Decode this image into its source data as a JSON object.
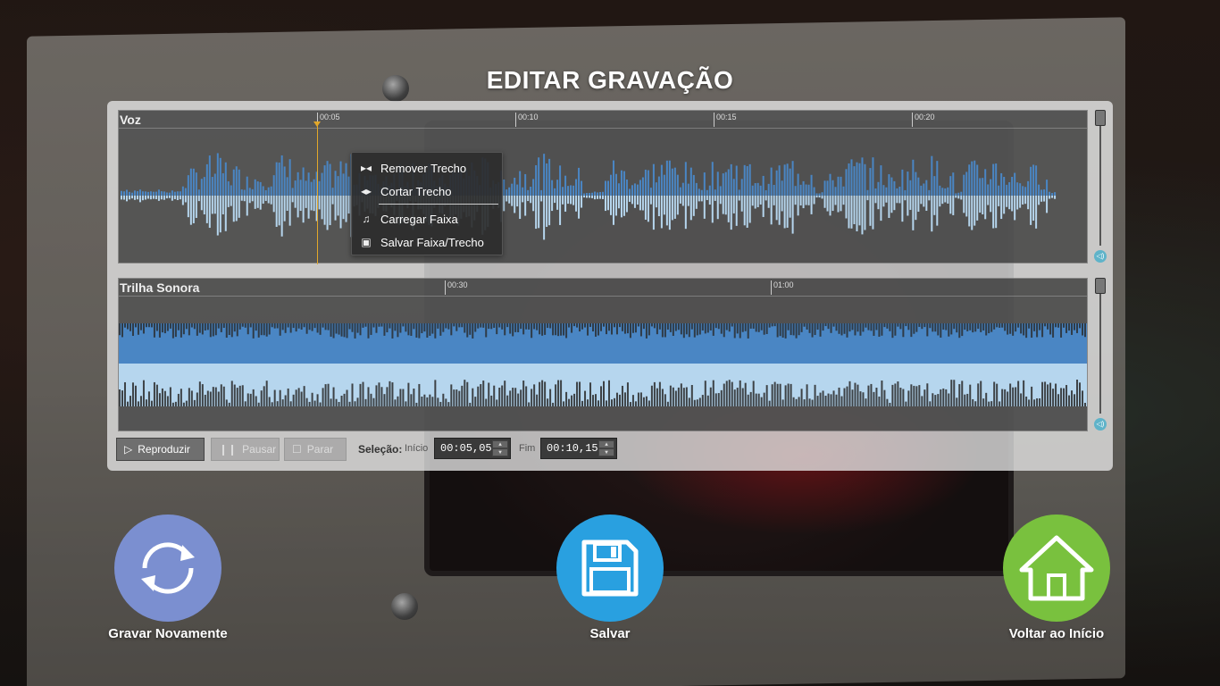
{
  "title": "EDITAR GRAVAÇÃO",
  "tracks": {
    "voz": {
      "label": "Voz",
      "ticks": [
        "00:05",
        "00:10",
        "00:15",
        "00:20"
      ]
    },
    "trilha": {
      "label": "Trilha Sonora",
      "ticks": [
        "00:30",
        "01:00"
      ]
    }
  },
  "context_menu": {
    "items": [
      {
        "label": "Remover Trecho",
        "icon": "remove-segment-icon"
      },
      {
        "label": "Cortar Trecho",
        "icon": "cut-segment-icon"
      },
      {
        "label": "Carregar Faixa",
        "icon": "music-note-icon"
      },
      {
        "label": "Salvar Faixa/Trecho",
        "icon": "floppy-disk-icon"
      }
    ]
  },
  "controls": {
    "play": "Reproduzir",
    "pause": "Pausar",
    "stop": "Parar",
    "selection_label": "Seleção:",
    "start_label": "Início",
    "start_value": "00:05,05",
    "end_label": "Fim",
    "end_value": "00:10,15"
  },
  "actions": {
    "record_again": "Gravar Novamente",
    "save": "Salvar",
    "home": "Voltar ao Início"
  },
  "colors": {
    "record_again": "#7b8fd0",
    "save": "#29a0e0",
    "home": "#79c13e",
    "wave_light": "#b6d6ee",
    "wave_dark": "#4a86c4",
    "cursor": "#e2a72a"
  }
}
